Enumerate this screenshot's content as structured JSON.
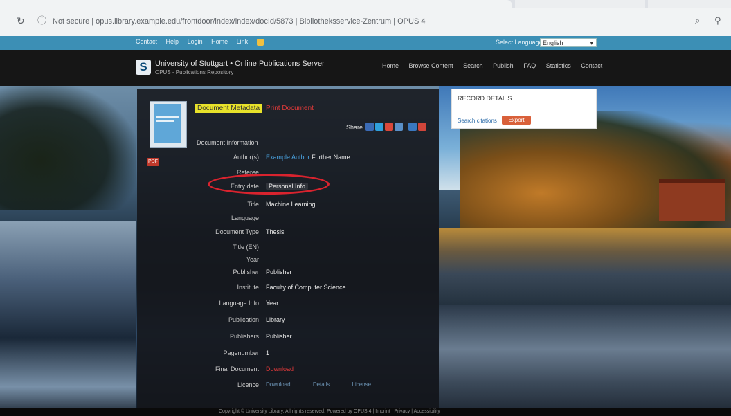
{
  "browser": {
    "url": "Not secure | opus.library.example.edu/frontdoor/index/index/docId/5873 | Bibliotheksservice-Zentrum | OPUS 4"
  },
  "topbar": {
    "links": [
      "Contact",
      "Help",
      "Login",
      "Home",
      "Link"
    ],
    "language_label": "Select Language:",
    "language_value": "English"
  },
  "header": {
    "site_title": "University of Stuttgart • Online Publications Server",
    "site_subtitle": "OPUS - Publications Repository",
    "nav": [
      "Home",
      "Browse Content",
      "Search",
      "Publish",
      "FAQ",
      "Statistics",
      "Contact"
    ]
  },
  "doc": {
    "title_highlight": "Document Metadata",
    "title_subtitle": "Print Document",
    "share_label": "Share",
    "content_intro": "Document Information",
    "pdf_label": "PDF",
    "highlighted_value": "Personal Info",
    "rows": [
      {
        "label": "Author(s)",
        "value": "Example Author",
        "extra": "Further Name"
      },
      {
        "label": "Referee",
        "value": ""
      },
      {
        "label": "Entry date",
        "value": "Personal Info"
      },
      {
        "label": "Title",
        "value": "Machine Learning"
      },
      {
        "label": "Language",
        "value": ""
      },
      {
        "label": "Document Type",
        "value": "Thesis"
      },
      {
        "label": "Title (EN)",
        "value": ""
      },
      {
        "label": "Year",
        "value": ""
      },
      {
        "label": "Publisher",
        "value": "Publisher"
      },
      {
        "label": "Institute",
        "value": "Faculty of Computer Science"
      },
      {
        "label": "Language Info",
        "value": "Year"
      },
      {
        "label": "Publication",
        "value": "Library"
      },
      {
        "label": "Publishers",
        "value": "Publisher"
      },
      {
        "label": "Pagenumber",
        "value": "1"
      },
      {
        "label": "Final Document",
        "value": "Download"
      },
      {
        "label": "Licence",
        "value": ""
      }
    ],
    "bottom_links": [
      "Download",
      "Details",
      "License"
    ]
  },
  "widget": {
    "title": "RECORD DETAILS",
    "text": "Search citations",
    "button": "Export"
  },
  "footer": {
    "text": "Copyright © University Library. All rights reserved. Powered by OPUS 4 | Imprint | Privacy | Accessibility"
  }
}
